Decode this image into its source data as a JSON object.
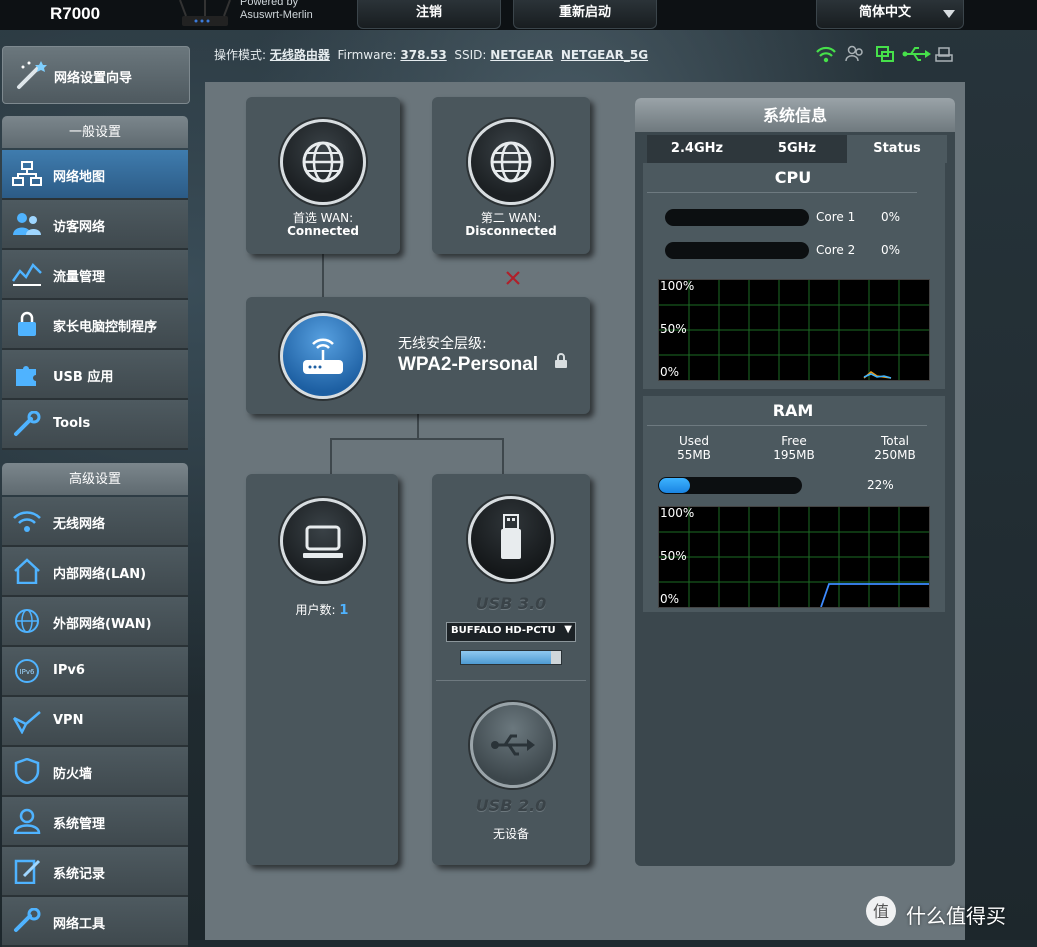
{
  "header": {
    "model": "R7000",
    "powered_line1": "Powered by",
    "powered_line2": "Asuswrt-Merlin",
    "logout": "注销",
    "reboot": "重新启动",
    "language": "简体中文"
  },
  "sidebar": {
    "wizard": "网络设置向导",
    "general_title": "一般设置",
    "general_items": [
      {
        "label": "网络地图",
        "icon": "network-map-icon",
        "active": true
      },
      {
        "label": "访客网络",
        "icon": "guest-network-icon"
      },
      {
        "label": "流量管理",
        "icon": "traffic-manager-icon"
      },
      {
        "label": "家长电脑控制程序",
        "icon": "parental-control-icon"
      },
      {
        "label": "USB 应用",
        "icon": "usb-app-icon"
      },
      {
        "label": "Tools",
        "icon": "tools-icon"
      }
    ],
    "advanced_title": "高级设置",
    "advanced_items": [
      {
        "label": "无线网络",
        "icon": "wireless-icon"
      },
      {
        "label": "内部网络(LAN)",
        "icon": "lan-icon"
      },
      {
        "label": "外部网络(WAN)",
        "icon": "wan-icon"
      },
      {
        "label": "IPv6",
        "icon": "ipv6-icon"
      },
      {
        "label": "VPN",
        "icon": "vpn-icon"
      },
      {
        "label": "防火墙",
        "icon": "firewall-icon"
      },
      {
        "label": "系统管理",
        "icon": "administration-icon"
      },
      {
        "label": "系统记录",
        "icon": "system-log-icon"
      },
      {
        "label": "网络工具",
        "icon": "network-tools-icon"
      }
    ]
  },
  "status": {
    "mode_label": "操作模式:",
    "mode_value": "无线路由器",
    "fw_label": "Firmware:",
    "fw_value": "378.53",
    "ssid_label": "SSID:",
    "ssid1": "NETGEAR",
    "ssid2": "NETGEAR_5G",
    "icons": [
      "wifi-icon",
      "clients-icon",
      "network-icon",
      "usb-icon",
      "printer-icon"
    ]
  },
  "map": {
    "wan1_label": "首选 WAN:",
    "wan1_status": "Connected",
    "wan2_label": "第二 WAN:",
    "wan2_status": "Disconnected",
    "security_label": "无线安全层级:",
    "security_value": "WPA2-Personal",
    "clients_label": "用户数:",
    "clients_value": "1",
    "usb3_label": "USB 3.0",
    "usb3_device": "BUFFALO HD-PCTU",
    "usb3_fill": 0.9,
    "usb2_label": "USB 2.0",
    "usb2_status": "无设备"
  },
  "sysinfo": {
    "title": "系统信息",
    "tabs": [
      "2.4GHz",
      "5GHz",
      "Status"
    ],
    "active_tab": 2,
    "cpu_title": "CPU",
    "cores": [
      {
        "name": "Core 1",
        "value": "0%"
      },
      {
        "name": "Core 2",
        "value": "0%"
      }
    ],
    "cpu_graph_labels": [
      "100%",
      "50%",
      "0%"
    ],
    "ram_title": "RAM",
    "ram_cols": [
      {
        "label": "Used",
        "value": "55MB"
      },
      {
        "label": "Free",
        "value": "195MB"
      },
      {
        "label": "Total",
        "value": "250MB"
      }
    ],
    "ram_percent": "22%",
    "ram_fill": 0.22,
    "ram_graph_labels": [
      "100%",
      "50%",
      "0%"
    ]
  },
  "watermark": "什么值得买"
}
